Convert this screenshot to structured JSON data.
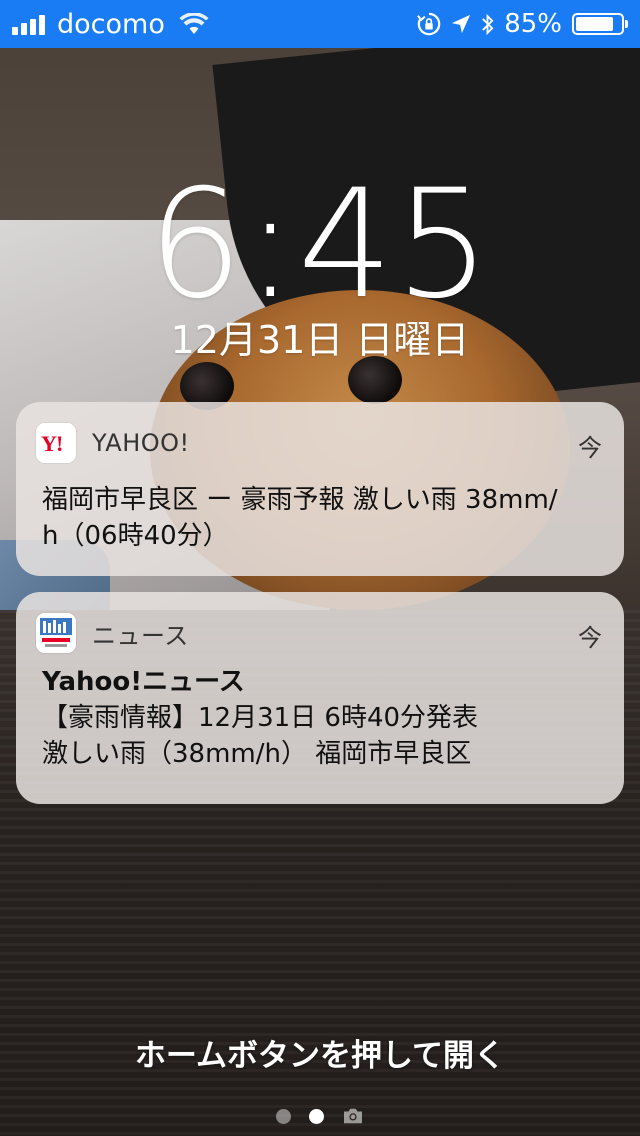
{
  "status_bar": {
    "carrier": "docomo",
    "battery_percent": "85%",
    "battery_level": 0.85,
    "icons": [
      "signal-icon",
      "wifi-icon",
      "orientation-lock-icon",
      "location-icon",
      "bluetooth-icon",
      "battery-icon"
    ]
  },
  "lock": {
    "time": "6:45",
    "date": "12月31日 日曜日",
    "unlock_hint": "ホームボタンを押して開く"
  },
  "notifications": [
    {
      "app": "YAHOO!",
      "time": "今",
      "title": "",
      "body_line1": "福岡市早良区 ー 豪雨予報 激しい雨 38mm/",
      "body_line2": "h（06時40分）",
      "icon": "yahoo-app-icon"
    },
    {
      "app": "ニュース",
      "time": "今",
      "title": "Yahoo!ニュース",
      "body_line1": "【豪雨情報】12月31日 6時40分発表",
      "body_line2": "激しい雨（38mm/h） 福岡市早良区",
      "icon": "yahoo-news-app-icon"
    }
  ],
  "colors": {
    "status_bar": "#1a7cf5",
    "yahoo_red": "#e60026"
  }
}
